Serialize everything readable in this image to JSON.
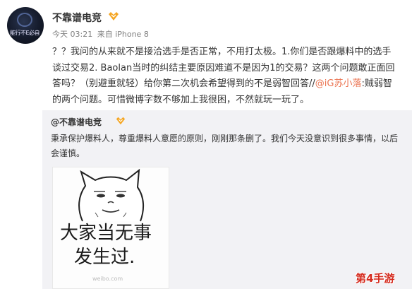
{
  "post": {
    "avatar_text": "能行不E必自",
    "username": "不靠谱电竞",
    "time": "今天 03:21",
    "source": "来自 iPhone 8",
    "content": {
      "text1": "？？我问的从来就不是接洽选手是否正常，不用打太极。1.你们是否跟爆料中的选手谈过交易2. Baolan当时的纠结主要原因难道不是因为1的交易？这两个问题敢正面回答吗？（别避重就轻）给你第二次机会希望得到的不是弱智回答//",
      "mention": "@iG苏小落",
      "text2": ":贼弱智的两个问题。可惜微博字数不够加上我很困，不然就玩一玩了。"
    }
  },
  "repost": {
    "username": "@不靠谱电竞",
    "text": "秉承保护爆料人，尊重爆料人意愿的原则，刚刚那条删了。我们今天没意识到很多事情，以后会谨慎。",
    "meme": {
      "line1": "大家当无事",
      "line2": "发生过.",
      "watermark": "weibo.com"
    }
  },
  "site_watermark": "第4手游",
  "colors": {
    "mention": "#eb7350",
    "vip": "#f5a623",
    "watermark": "#d52b1e"
  }
}
